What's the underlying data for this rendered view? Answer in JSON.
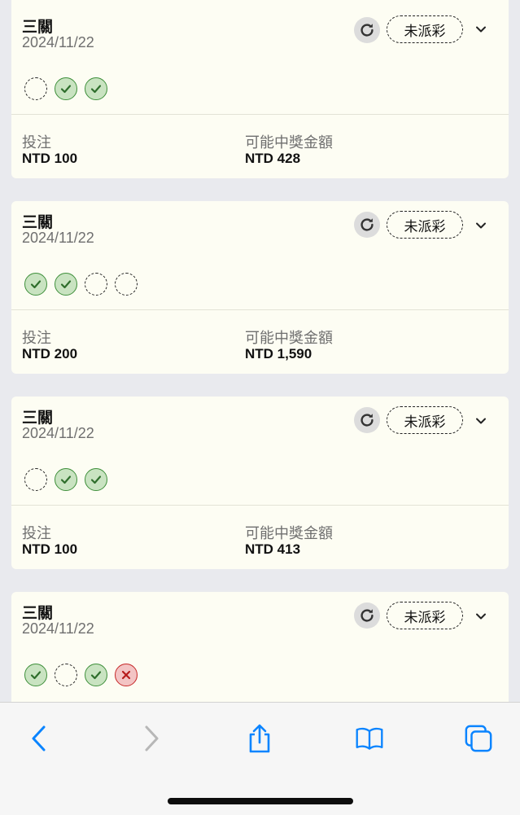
{
  "cards": [
    {
      "title": "三關",
      "date": "2024/11/22",
      "status": "未派彩",
      "legs": [
        "pending",
        "win",
        "win"
      ],
      "stake_label": "投注",
      "stake_value": "NTD 100",
      "payout_label": "可能中獎金額",
      "payout_value": "NTD 428"
    },
    {
      "title": "三關",
      "date": "2024/11/22",
      "status": "未派彩",
      "legs": [
        "win",
        "win",
        "pending",
        "pending"
      ],
      "stake_label": "投注",
      "stake_value": "NTD 200",
      "payout_label": "可能中獎金額",
      "payout_value": "NTD 1,590"
    },
    {
      "title": "三關",
      "date": "2024/11/22",
      "status": "未派彩",
      "legs": [
        "pending",
        "win",
        "win"
      ],
      "stake_label": "投注",
      "stake_value": "NTD 100",
      "payout_label": "可能中獎金額",
      "payout_value": "NTD 413"
    },
    {
      "title": "三關",
      "date": "2024/11/22",
      "status": "未派彩",
      "legs": [
        "win",
        "pending",
        "win",
        "lose"
      ]
    }
  ],
  "icons": {
    "refresh": "refresh-icon",
    "expand": "chevron-down-icon",
    "win": "check-circle-icon",
    "lose": "x-circle-icon",
    "pending": "dashed-circle-icon",
    "back": "chevron-left-icon",
    "forward": "chevron-right-icon",
    "share": "share-icon",
    "bookmarks": "book-icon",
    "tabs": "tabs-icon"
  },
  "colors": {
    "accent": "#0a84ff",
    "win": "#3e8f3a",
    "lose": "#c62828",
    "card_bg": "#fdfdf3",
    "page_bg": "#e9eaee"
  }
}
